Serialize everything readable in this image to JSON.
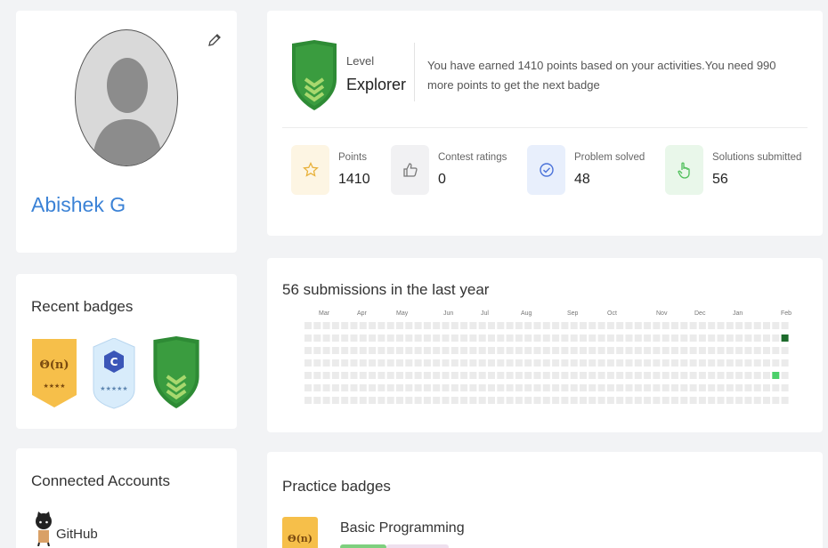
{
  "profile": {
    "name": "Abishek G",
    "edit_icon": "pencil-icon"
  },
  "level": {
    "label": "Level",
    "name": "Explorer",
    "message": "You have earned 1410 points based on your activities.You need 990 more points to get the next badge",
    "shield_color": "#2e8b35"
  },
  "stats": [
    {
      "label": "Points",
      "value": "1410",
      "icon": "star-icon",
      "bg": "#fdf5e3",
      "color": "#e8b13a"
    },
    {
      "label": "Contest ratings",
      "value": "0",
      "icon": "thumbs-up-icon",
      "bg": "#f1f1f3",
      "color": "#888"
    },
    {
      "label": "Problem solved",
      "value": "48",
      "icon": "check-circle-icon",
      "bg": "#e8effc",
      "color": "#4a72d9"
    },
    {
      "label": "Solutions submitted",
      "value": "56",
      "icon": "hand-pointer-icon",
      "bg": "#e9f7ea",
      "color": "#4fbf5a"
    }
  ],
  "submissions": {
    "title": "56 submissions in the last year",
    "months": [
      "Mar",
      "Apr",
      "May",
      "Jun",
      "Jul",
      "Aug",
      "Sep",
      "Oct",
      "Nov",
      "Dec",
      "Jan",
      "Feb"
    ],
    "weeks": 53,
    "days": 7,
    "active_cells": [
      {
        "week": 53,
        "day": 1,
        "level": 2
      },
      {
        "week": 52,
        "day": 4,
        "level": 1
      }
    ],
    "colors": {
      "empty": "#ebebeb",
      "level1": "#4bd06a",
      "level2": "#1d6b2c"
    }
  },
  "recent_badges": {
    "title": "Recent badges",
    "items": [
      {
        "name": "complexity-badge",
        "text": "Θ(n)",
        "stars": "★★★★",
        "color": "#f6bf4a"
      },
      {
        "name": "c-language-badge",
        "text": "C",
        "stars": "★★★★★",
        "color": "#d8ecfb"
      },
      {
        "name": "explorer-badge",
        "text": "",
        "stars": "",
        "color": "#2e8b35"
      }
    ]
  },
  "connected": {
    "title": "Connected Accounts",
    "github": "GitHub"
  },
  "practice": {
    "title": "Practice badges",
    "badge_text": "Θ(n)",
    "name": "Basic Programming"
  }
}
